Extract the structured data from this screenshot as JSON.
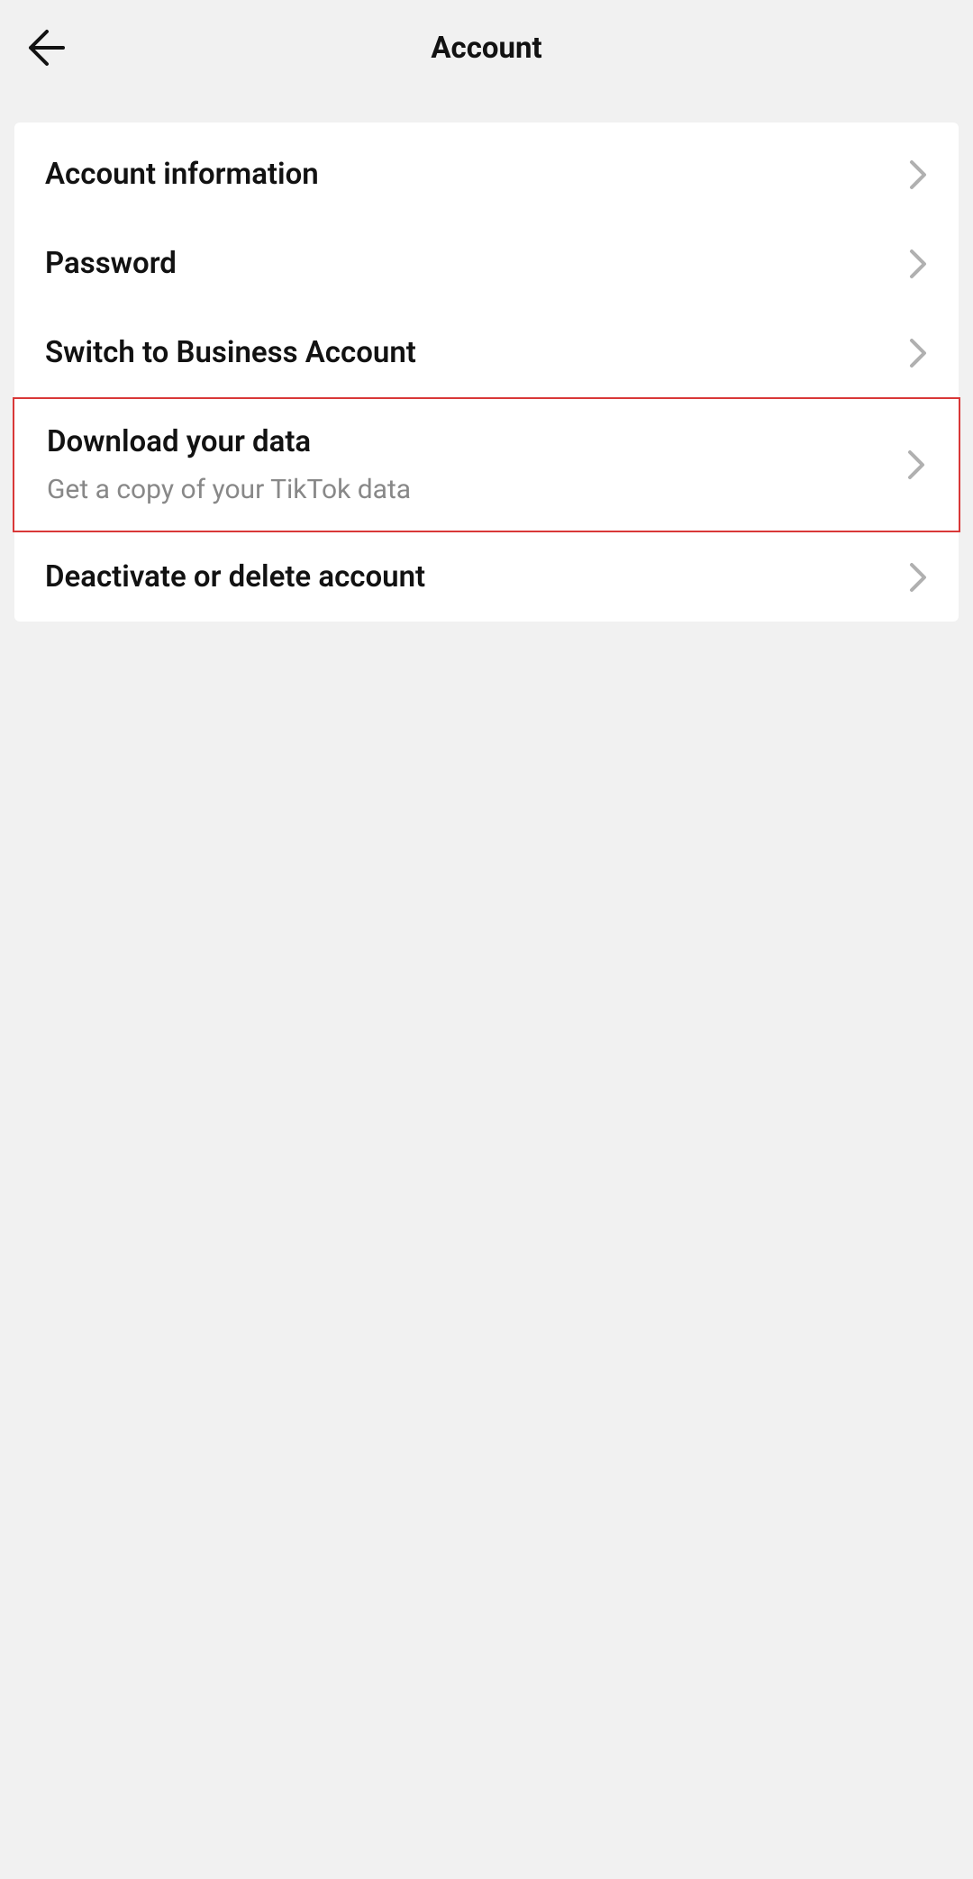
{
  "header": {
    "title": "Account"
  },
  "items": [
    {
      "title": "Account information",
      "subtitle": null,
      "highlighted": false
    },
    {
      "title": "Password",
      "subtitle": null,
      "highlighted": false
    },
    {
      "title": "Switch to Business Account",
      "subtitle": null,
      "highlighted": false
    },
    {
      "title": "Download your data",
      "subtitle": "Get a copy of your TikTok data",
      "highlighted": true
    },
    {
      "title": "Deactivate or delete account",
      "subtitle": null,
      "highlighted": false
    }
  ]
}
